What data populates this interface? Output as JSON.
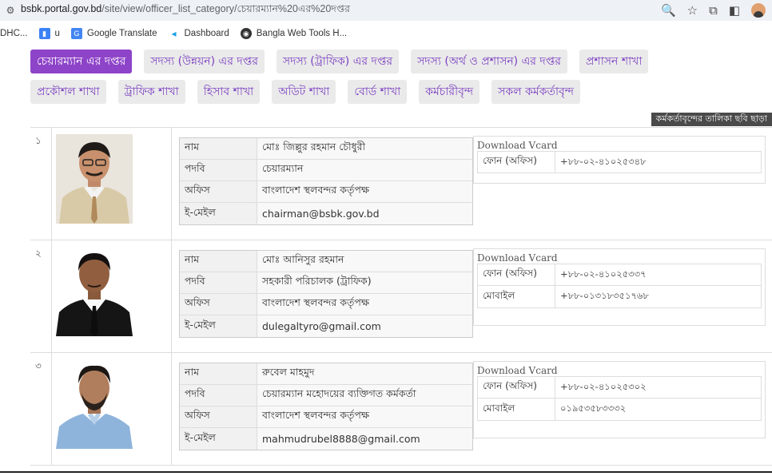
{
  "browser": {
    "url_host": "bsbk.portal.gov.bd",
    "url_path": "/site/view/officer_list_category/চেয়ারম্যান%20এর%20দপ্তর",
    "bookmarks": [
      {
        "label": "DHC...",
        "icon": "none"
      },
      {
        "label": "u",
        "icon": "bookmark-blue-icon"
      },
      {
        "label": "Google Translate",
        "icon": "translate-icon"
      },
      {
        "label": "Dashboard",
        "icon": "dashboard-icon"
      },
      {
        "label": "Bangla Web Tools H...",
        "icon": "globe-icon"
      }
    ]
  },
  "tabs": {
    "row1": [
      "চেয়ারম্যান এর দপ্তর",
      "সদস্য (উন্নয়ন) এর দপ্তর",
      "সদস্য (ট্রাফিক) এর দপ্তর",
      "সদস্য (অর্থ ও প্রশাসন) এর দপ্তর",
      "প্রশাসন শাখা"
    ],
    "row2": [
      "প্রকৌশল শাখা",
      "ট্রাফিক শাখা",
      "হিসাব শাখা",
      "অডিট শাখা",
      "বোর্ড শাখা",
      "কর্মচারীবৃন্দ",
      "সকল কর্মকর্তাবৃন্দ"
    ],
    "active": "চেয়ারম্যান এর দপ্তর"
  },
  "section_tag": "কর্মকর্তাবৃন্দের তালিকা ছবি ছাড়া",
  "labels": {
    "name": "নাম",
    "designation": "পদবি",
    "office": "অফিস",
    "email": "ই-মেইল",
    "download_vcard": "Download Vcard",
    "phone_office": "ফোন (অফিস)",
    "mobile": "মোবাইল"
  },
  "officers": [
    {
      "sl": "১",
      "name": "মোঃ জিল্লুর রহমান চৌধুরী",
      "designation": "চেয়ারম্যান",
      "office": "বাংলাদেশ স্থলবন্দর কর্তৃপক্ষ",
      "email": "chairman@bsbk.gov.bd",
      "phone_office": "+৮৮-০২-৪১০২৫৩৪৮",
      "mobile": ""
    },
    {
      "sl": "২",
      "name": "মোঃ আনিসুর রহমান",
      "designation": "সহকারী পরিচালক (ট্রাফিক)",
      "office": "বাংলাদেশ স্থলবন্দর কর্তৃপক্ষ",
      "email": "dulegaltyro@gmail.com",
      "phone_office": "+৮৮-০২-৪১০২৫৩৩৭",
      "mobile": "+৮৮-০১৩১৮৩৫১৭৬৮"
    },
    {
      "sl": "৩",
      "name": "রুবেল মাহমুদ",
      "designation": "চেয়ারম্যান মহোদয়ের ব্যক্তিগত কর্মকর্তা",
      "office": "বাংলাদেশ স্থলবন্দর কর্তৃপক্ষ",
      "email": "mahmudrubel8888@gmail.com",
      "phone_office": "+৮৮-০২-৪১০২৫৩০২",
      "mobile": "০১৯৫৩৫৮৩৩৩২"
    }
  ]
}
